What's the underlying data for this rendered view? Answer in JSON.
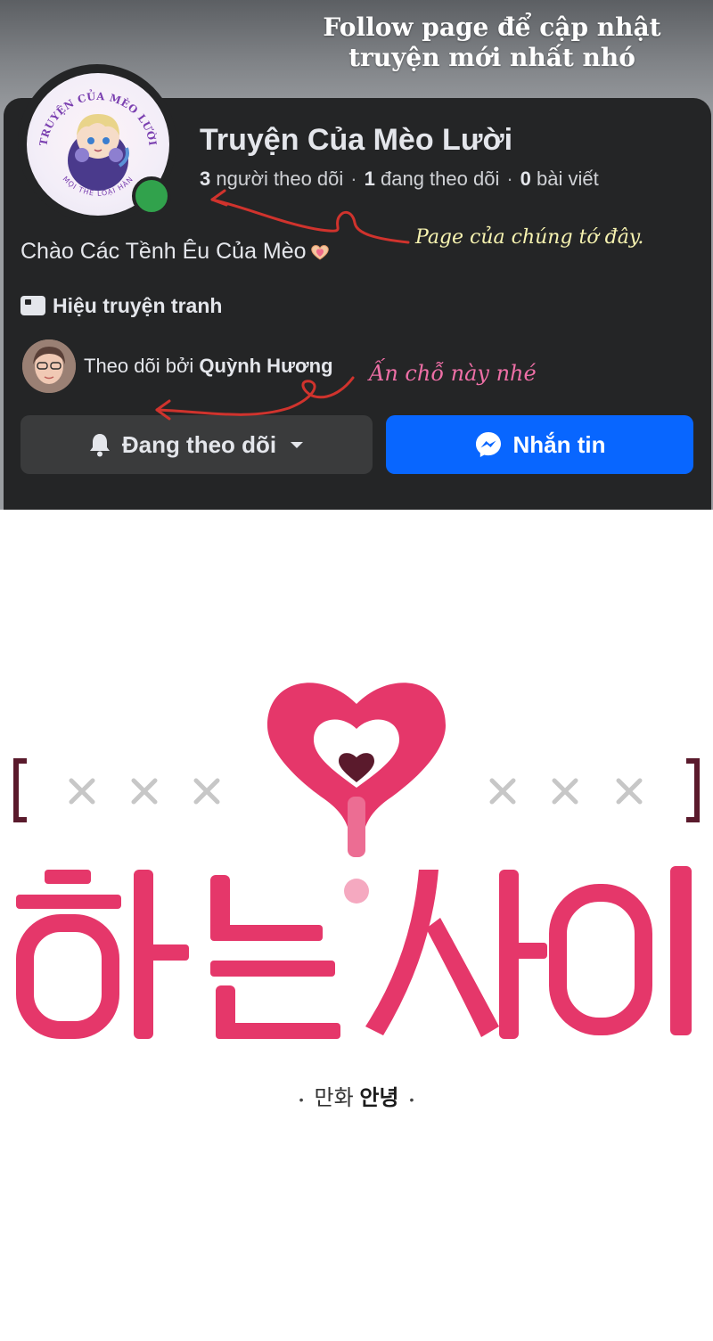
{
  "banner": {
    "title_line1": "Follow page để cập nhật",
    "title_line2": "truyện mới nhất nhó"
  },
  "page": {
    "avatar_text": "TRUYỆN CỦA MÈO LƯỜI",
    "avatar_subtext": "MỌI THỂ LOẠI HÀN",
    "name": "Truyện Của Mèo Lười",
    "followers_count": "3",
    "followers_label": "người theo dõi",
    "following_count": "1",
    "following_label": "đang theo dõi",
    "posts_count": "0",
    "posts_label": "bài viết",
    "greeting": "Chào Các Tềnh Êu Của Mèo",
    "category": "Hiệu truyện tranh",
    "followed_by_prefix": "Theo dõi bởi",
    "followed_by_name": "Quỳnh Hương"
  },
  "annotations": {
    "note_page": "Page của chúng tớ đây.",
    "note_click": "Ấn chỗ này nhé"
  },
  "buttons": {
    "follow_label": "Đang theo dõi",
    "message_label": "Nhắn tin"
  },
  "colors": {
    "card_bg": "#242526",
    "follow_btn": "#3a3b3c",
    "message_btn": "#0866ff",
    "online": "#31a24c",
    "arrow": "#d0332d",
    "logo_pink": "#e5376a",
    "logo_dark": "#5a1a2c"
  },
  "logo": {
    "title": "하는사이",
    "marks": "× × ×",
    "subtitle_normal": "만화",
    "subtitle_bold": "안녕",
    "bullet": "•"
  }
}
